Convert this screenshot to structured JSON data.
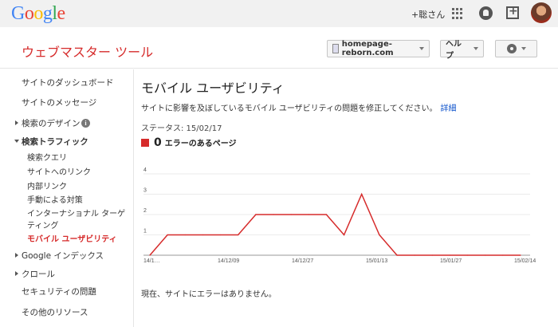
{
  "gbar": {
    "logo_letters": [
      {
        "ch": "G",
        "color": "#4285f4"
      },
      {
        "ch": "o",
        "color": "#ea4335"
      },
      {
        "ch": "o",
        "color": "#fbbc05"
      },
      {
        "ch": "g",
        "color": "#4285f4"
      },
      {
        "ch": "l",
        "color": "#34a853"
      },
      {
        "ch": "e",
        "color": "#ea4335"
      }
    ],
    "user": "+聡さん",
    "icons": [
      "apps-grid-icon",
      "notifications-bell-icon",
      "share-plus-icon",
      "avatar"
    ]
  },
  "header": {
    "title": "ウェブマスター ツール",
    "site_select": "homepage-reborn.com",
    "help_label": "ヘルプ",
    "accent": "#d62b2b"
  },
  "sidebar": {
    "dashboard": "サイトのダッシュボード",
    "messages": "サイトのメッセージ",
    "search_appearance": "検索のデザイン",
    "search_traffic": "検索トラフィック",
    "traffic_items": [
      "検索クエリ",
      "サイトへのリンク",
      "内部リンク",
      "手動による対策",
      "インターナショナル ターゲ",
      "ティング",
      "モバイル ユーザビリティ"
    ],
    "google_index": "Google インデックス",
    "crawl": "クロール",
    "security": "セキュリティの問題",
    "other": "その他のリソース"
  },
  "main": {
    "title": "モバイル ユーザビリティ",
    "description": "サイトに影響を及ぼしているモバイル ユーザビリティの問題を修正してください。",
    "details_link": "詳細",
    "status": "ステータス: 15/02/17",
    "error_count": "0",
    "legend_label": "エラーのあるページ",
    "footer": "現在、サイトにエラーはありません。"
  },
  "chart_data": {
    "type": "line",
    "x_ticks": [
      "14/1…",
      "14/12/09",
      "14/12/27",
      "15/01/13",
      "15/01/27",
      "15/02/14"
    ],
    "y_ticks": [
      "1",
      "2",
      "3",
      "4"
    ],
    "ylim": [
      0,
      4
    ],
    "series": [
      {
        "color": "#d62b2b",
        "values": [
          0,
          1,
          1,
          1,
          1,
          1,
          2,
          2,
          2,
          2,
          2,
          1,
          3,
          1,
          0,
          0,
          0,
          0,
          0,
          0,
          0,
          0
        ]
      }
    ]
  }
}
